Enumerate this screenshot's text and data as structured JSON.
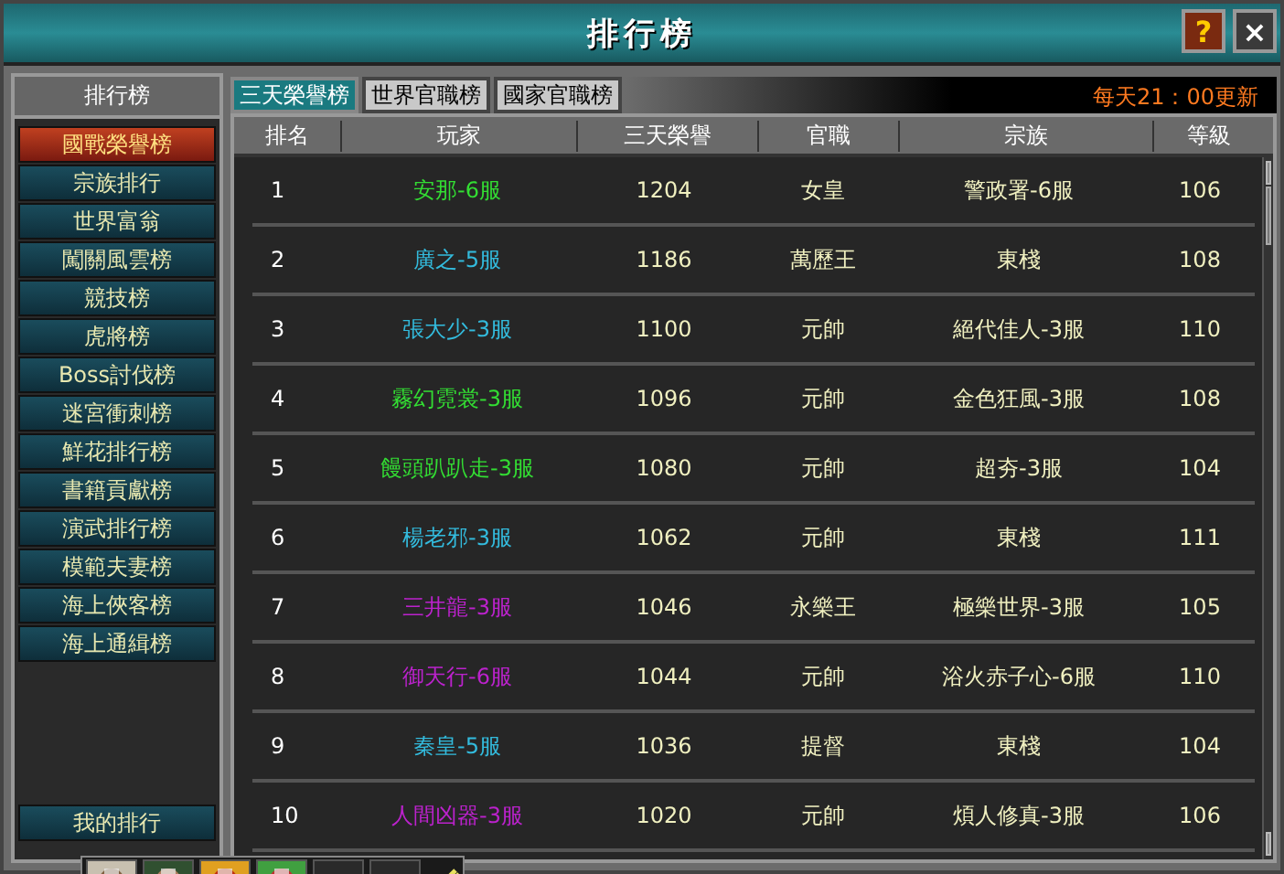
{
  "window": {
    "title": "排行榜",
    "help_button": "?",
    "close_button": "×"
  },
  "sidebar": {
    "title": "排行榜",
    "items": [
      {
        "label": "國戰榮譽榜",
        "selected": true
      },
      {
        "label": "宗族排行",
        "selected": false
      },
      {
        "label": "世界富翁",
        "selected": false
      },
      {
        "label": "闖關風雲榜",
        "selected": false
      },
      {
        "label": "競技榜",
        "selected": false
      },
      {
        "label": "虎將榜",
        "selected": false
      },
      {
        "label": "Boss討伐榜",
        "selected": false
      },
      {
        "label": "迷宮衝刺榜",
        "selected": false
      },
      {
        "label": "鮮花排行榜",
        "selected": false
      },
      {
        "label": "書籍貢獻榜",
        "selected": false
      },
      {
        "label": "演武排行榜",
        "selected": false
      },
      {
        "label": "模範夫妻榜",
        "selected": false
      },
      {
        "label": "海上俠客榜",
        "selected": false
      },
      {
        "label": "海上通緝榜",
        "selected": false
      }
    ],
    "my_rank_button": "我的排行"
  },
  "tabs": [
    {
      "label": "三天榮譽榜",
      "selected": true
    },
    {
      "label": "世界官職榜",
      "selected": false
    },
    {
      "label": "國家官職榜",
      "selected": false
    }
  ],
  "update_notice": "每天21：00更新",
  "table": {
    "columns": [
      "排名",
      "玩家",
      "三天榮譽",
      "官職",
      "宗族",
      "等級"
    ],
    "rows": [
      {
        "rank": "1",
        "player": "安那-6服",
        "color": "#33dd33",
        "honor": "1204",
        "title": "女皇",
        "clan": "警政署-6服",
        "level": "106"
      },
      {
        "rank": "2",
        "player": "廣之-5服",
        "color": "#33bbdd",
        "honor": "1186",
        "title": "萬歷王",
        "clan": "東棧",
        "level": "108"
      },
      {
        "rank": "3",
        "player": "張大少-3服",
        "color": "#33bbdd",
        "honor": "1100",
        "title": "元帥",
        "clan": "絕代佳人-3服",
        "level": "110"
      },
      {
        "rank": "4",
        "player": "霧幻霓裳-3服",
        "color": "#33dd33",
        "honor": "1096",
        "title": "元帥",
        "clan": "金色狂風-3服",
        "level": "108"
      },
      {
        "rank": "5",
        "player": "饅頭趴趴走-3服",
        "color": "#33dd33",
        "honor": "1080",
        "title": "元帥",
        "clan": "超夯-3服",
        "level": "104"
      },
      {
        "rank": "6",
        "player": "楊老邪-3服",
        "color": "#33bbdd",
        "honor": "1062",
        "title": "元帥",
        "clan": "東棧",
        "level": "111"
      },
      {
        "rank": "7",
        "player": "三井龍-3服",
        "color": "#bb22cc",
        "honor": "1046",
        "title": "永樂王",
        "clan": "極樂世界-3服",
        "level": "105"
      },
      {
        "rank": "8",
        "player": "御天行-6服",
        "color": "#bb22cc",
        "honor": "1044",
        "title": "元帥",
        "clan": "浴火赤子心-6服",
        "level": "110"
      },
      {
        "rank": "9",
        "player": "秦皇-5服",
        "color": "#33bbdd",
        "honor": "1036",
        "title": "提督",
        "clan": "東棧",
        "level": "104"
      },
      {
        "rank": "10",
        "player": "人間凶器-3服",
        "color": "#bb22cc",
        "honor": "1020",
        "title": "元帥",
        "clan": "煩人修真-3服",
        "level": "106"
      }
    ]
  },
  "hotbar": {
    "slots": [
      {
        "kind": "item"
      },
      {
        "kind": "item"
      },
      {
        "kind": "item"
      },
      {
        "kind": "item"
      },
      {
        "kind": "empty"
      },
      {
        "kind": "empty"
      }
    ]
  }
}
